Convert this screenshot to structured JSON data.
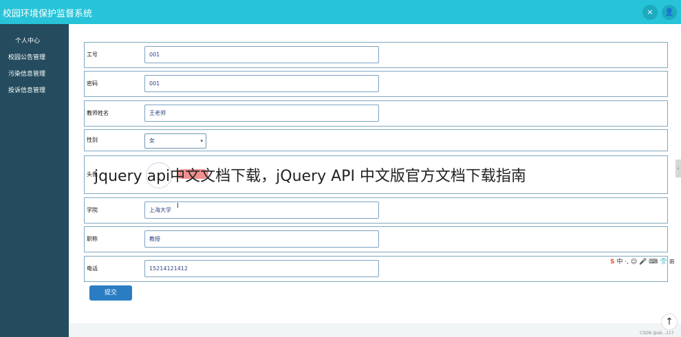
{
  "header": {
    "title": "校园环境保护监督系统",
    "close_icon": "×",
    "user_icon": "👤"
  },
  "sidebar": {
    "items": [
      {
        "label": "个人中心"
      },
      {
        "label": "校园公告管理"
      },
      {
        "label": "污染信息管理"
      },
      {
        "label": "投诉信息管理"
      }
    ]
  },
  "form": {
    "fields": {
      "id": {
        "label": "工号",
        "value": "001"
      },
      "password": {
        "label": "密码",
        "value": "001"
      },
      "name": {
        "label": "教师姓名",
        "value": "王老师"
      },
      "gender": {
        "label": "性别",
        "value": "女"
      },
      "avatar": {
        "label": "头像"
      },
      "college": {
        "label": "学院",
        "value": "上海大学"
      },
      "title": {
        "label": "职称",
        "value": "教授"
      },
      "phone": {
        "label": "电话",
        "value": "15214121412"
      }
    },
    "submit_label": "提交"
  },
  "overlay_caption": "jquery api中文文档下载，jQuery API 中文版官方文档下载指南",
  "ime": {
    "logo": "S",
    "text": "中 ·, ☺ 🎤 ⌨ 👕 ⊞"
  },
  "credit": "CSDN @ab...117",
  "colors": {
    "topbar": "#27c3d8",
    "sidebar": "#244c5e",
    "submit": "#2a7dc2"
  },
  "icons": [
    "close-icon",
    "user-icon",
    "chevron-down-icon",
    "arrow-up-icon",
    "play-icon"
  ]
}
